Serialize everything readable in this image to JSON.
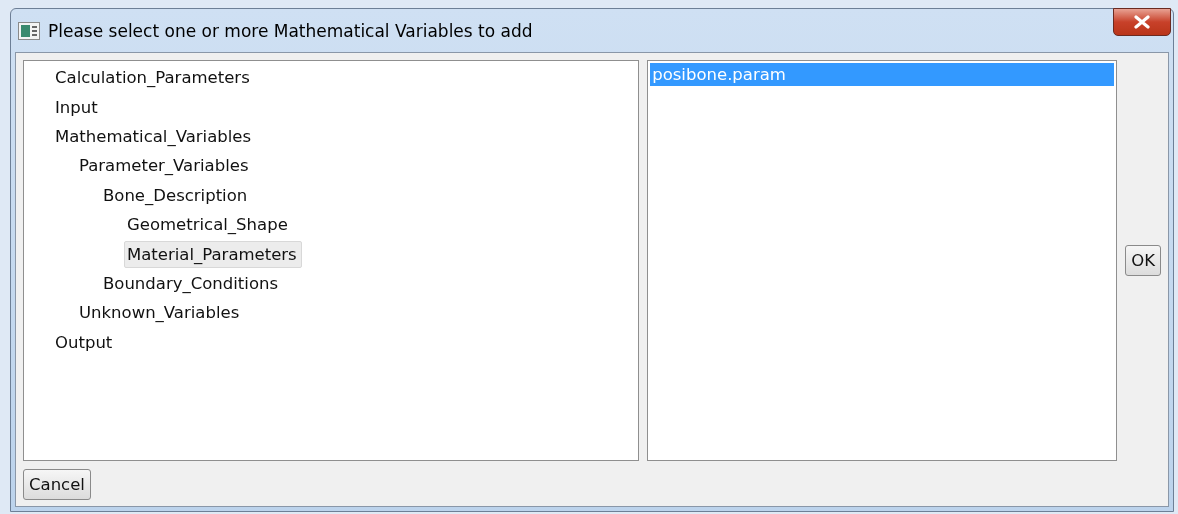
{
  "window": {
    "title": "Please select one or more Mathematical Variables to add"
  },
  "tree": [
    {
      "label": "Calculation_Parameters",
      "selected": false
    },
    {
      "label": "Input",
      "selected": false
    },
    {
      "label": "Mathematical_Variables",
      "selected": false,
      "children": [
        {
          "label": "Parameter_Variables",
          "selected": false,
          "children": [
            {
              "label": "Bone_Description",
              "selected": false,
              "children": [
                {
                  "label": "Geometrical_Shape",
                  "selected": false
                },
                {
                  "label": "Material_Parameters",
                  "selected": true
                }
              ]
            },
            {
              "label": "Boundary_Conditions",
              "selected": false
            }
          ]
        },
        {
          "label": "Unknown_Variables",
          "selected": false
        }
      ]
    },
    {
      "label": "Output",
      "selected": false
    }
  ],
  "list": [
    {
      "label": "posibone.param",
      "selected": true
    }
  ],
  "buttons": {
    "ok": "OK",
    "cancel": "Cancel"
  }
}
